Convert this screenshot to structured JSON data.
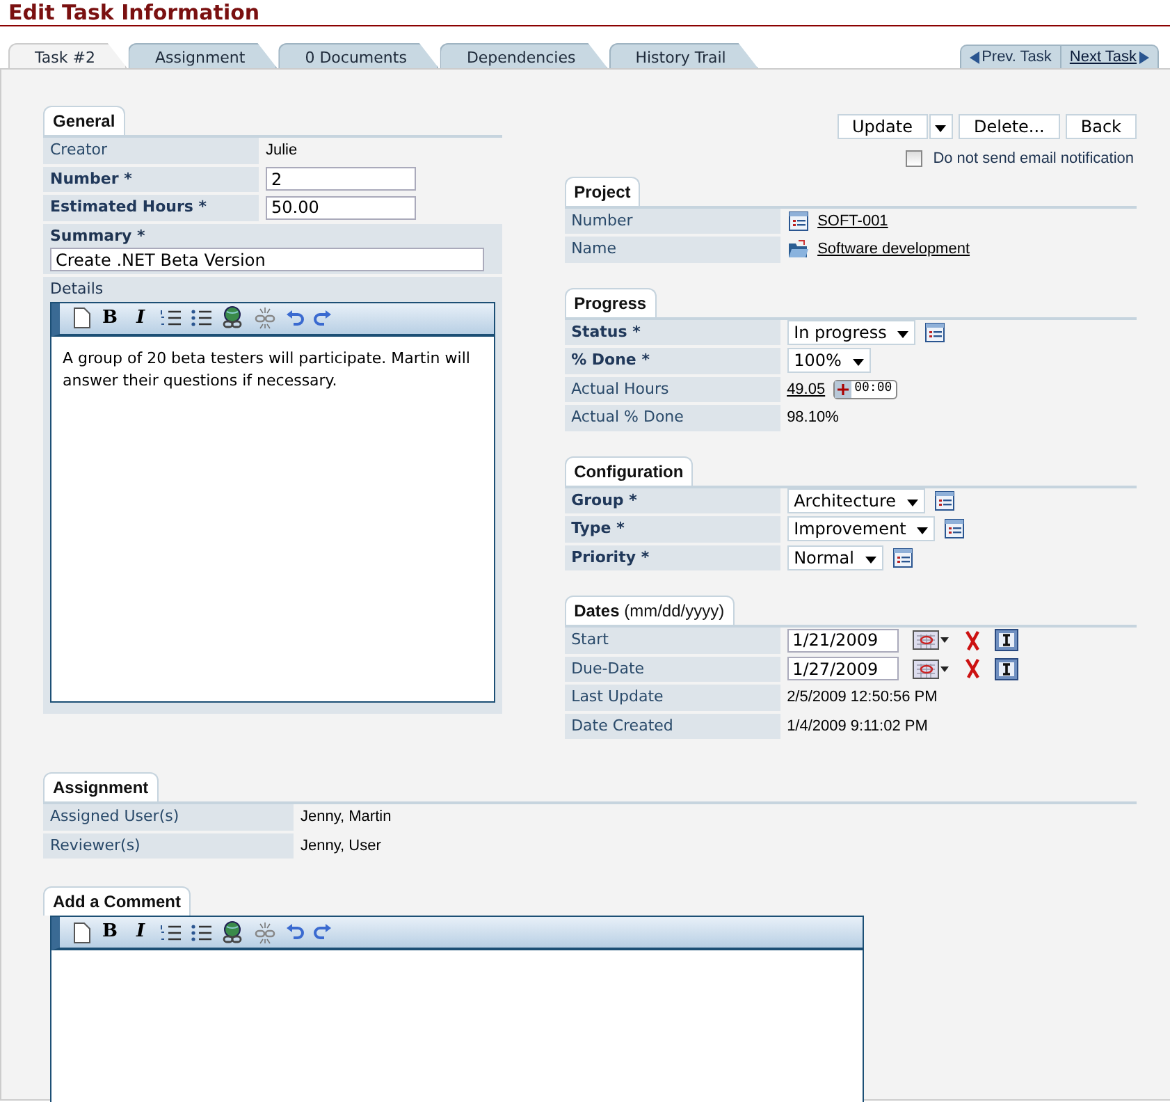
{
  "title": "Edit Task Information",
  "tabs": [
    {
      "label": "Task #2",
      "selected": true
    },
    {
      "label": "Assignment",
      "selected": false
    },
    {
      "label": "0 Documents",
      "selected": false
    },
    {
      "label": "Dependencies",
      "selected": false
    },
    {
      "label": "History Trail",
      "selected": false
    }
  ],
  "task_nav": {
    "previous": "Prev. Task",
    "next": "Next Task"
  },
  "general": {
    "title": "General",
    "rows": [
      {
        "label": "Creator",
        "bold": false,
        "kind": "text",
        "value": "Julie"
      },
      {
        "label": "Number *",
        "bold": true,
        "kind": "input",
        "value": "2"
      },
      {
        "label": "Estimated Hours *",
        "bold": true,
        "kind": "input",
        "value": "50.00"
      }
    ],
    "summary": {
      "label": "Summary *",
      "value": "Create .NET Beta Version"
    },
    "details": {
      "label": "Details",
      "text": "A group of 20 beta testers will participate. Martin will answer their questions if necessary.",
      "toolbar": [
        {
          "kind": "new"
        },
        {
          "kind": "bold",
          "glyph": "B"
        },
        {
          "kind": "italic",
          "glyph": "I"
        },
        {
          "kind": "ordered"
        },
        {
          "kind": "bullets"
        },
        {
          "kind": "link"
        },
        {
          "kind": "unlink"
        },
        {
          "kind": "undo"
        },
        {
          "kind": "redo"
        }
      ]
    }
  },
  "actions": {
    "buttons": [
      "Update",
      "Delete...",
      "Back"
    ],
    "notify": {
      "label": "Do not send email notification",
      "checked": false
    }
  },
  "project": {
    "title": "Project",
    "rows": [
      {
        "label": "Number",
        "bold": false,
        "kind": "link",
        "value": "SOFT-001"
      },
      {
        "label": "Name",
        "bold": false,
        "kind": "link",
        "value": "Software development"
      }
    ]
  },
  "progress": {
    "title": "Progress",
    "rows": [
      {
        "label": "Status *",
        "bold": true,
        "kind": "select",
        "value": "In progress",
        "list_button": true
      },
      {
        "label": "% Done *",
        "bold": true,
        "kind": "select",
        "value": "100%",
        "list_button": false
      },
      {
        "label": "Actual Hours",
        "bold": false,
        "kind": "hours",
        "value": "49.05",
        "timer": "00:00"
      },
      {
        "label": "Actual % Done",
        "bold": false,
        "kind": "text",
        "value": "98.10%"
      }
    ]
  },
  "configuration": {
    "title": "Configuration",
    "rows": [
      {
        "label": "Group *",
        "bold": true,
        "kind": "select",
        "value": "Architecture",
        "list_button": true
      },
      {
        "label": "Type *",
        "bold": true,
        "kind": "select",
        "value": "Improvement",
        "list_button": true
      },
      {
        "label": "Priority *",
        "bold": true,
        "kind": "select",
        "value": "Normal",
        "list_button": true
      }
    ]
  },
  "dates": {
    "title": "Dates",
    "hint": "(mm/dd/yyyy)",
    "rows": [
      {
        "label": "Start",
        "bold": false,
        "kind": "date",
        "value": "1/21/2009"
      },
      {
        "label": "Due-Date",
        "bold": false,
        "kind": "date",
        "value": "1/27/2009"
      },
      {
        "label": "Last Update",
        "bold": false,
        "kind": "text",
        "value": "2/5/2009 12:50:56 PM"
      },
      {
        "label": "Date Created",
        "bold": false,
        "kind": "text",
        "value": "1/4/2009 9:11:02 PM"
      }
    ]
  },
  "assignment": {
    "title": "Assignment",
    "rows": [
      {
        "label": "Assigned User(s)",
        "bold": false,
        "kind": "text",
        "value": "Jenny, Martin"
      },
      {
        "label": "Reviewer(s)",
        "bold": false,
        "kind": "text",
        "value": "Jenny, User"
      }
    ]
  },
  "comment": {
    "title": "Add a Comment",
    "toolbar": [
      {
        "kind": "new"
      },
      {
        "kind": "bold",
        "glyph": "B"
      },
      {
        "kind": "italic",
        "glyph": "I"
      },
      {
        "kind": "ordered"
      },
      {
        "kind": "bullets"
      },
      {
        "kind": "link"
      },
      {
        "kind": "unlink"
      },
      {
        "kind": "undo"
      },
      {
        "kind": "redo"
      }
    ]
  }
}
